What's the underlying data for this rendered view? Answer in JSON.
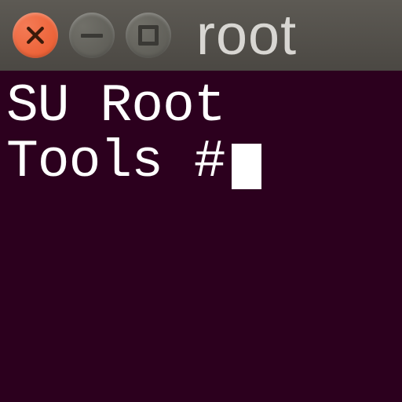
{
  "titlebar": {
    "close_icon": "×",
    "minimize_icon": "−",
    "maximize_icon": "□",
    "title": "root"
  },
  "terminal": {
    "line1": "SU Root",
    "line2": "Tools #"
  }
}
